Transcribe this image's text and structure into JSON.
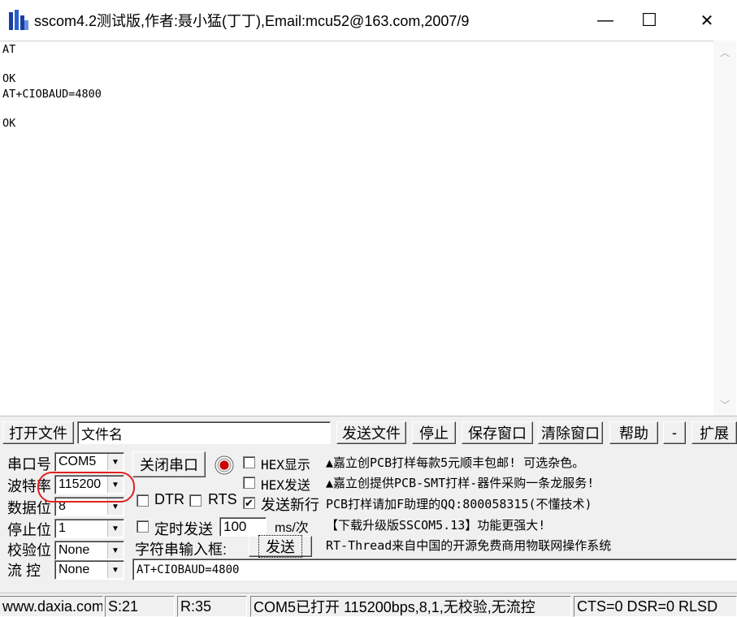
{
  "window": {
    "title": "sscom4.2测试版,作者:聂小猛(丁丁),Email:mcu52@163.com,2007/9",
    "minimize": "—",
    "maximize": "☐",
    "close": "✕"
  },
  "receive": {
    "text": "AT\n\nOK\nAT+CIOBAUD=4800\n\nOK"
  },
  "toolbar": {
    "open_file": "打开文件",
    "filename": "文件名",
    "send_file": "发送文件",
    "stop": "停止",
    "save_window": "保存窗口",
    "clear_window": "清除窗口",
    "help": "帮助",
    "collapse": "-",
    "expand": "扩展"
  },
  "settings": {
    "port_label": "串口号",
    "port_value": "COM5",
    "baud_label": "波特率",
    "baud_value": "115200",
    "databits_label": "数据位",
    "databits_value": "8",
    "stopbits_label": "停止位",
    "stopbits_value": "1",
    "parity_label": "校验位",
    "parity_value": "None",
    "flow_label": "流 控",
    "flow_value": "None"
  },
  "controls": {
    "close_port": "关闭串口",
    "hex_display": "HEX显示",
    "hex_send": "HEX发送",
    "dtr": "DTR",
    "rts": "RTS",
    "send_newline": "发送新行",
    "timed_send": "定时发送",
    "interval_value": "100",
    "interval_unit": "ms/次",
    "input_label": "字符串输入框:",
    "send": "发送",
    "input_value": "AT+CIOBAUD=4800"
  },
  "checkbox_states": {
    "hex_display": false,
    "hex_send": false,
    "dtr": false,
    "rts": false,
    "send_newline": true,
    "timed_send": false
  },
  "info": {
    "line1": "▲嘉立创PCB打样每款5元顺丰包邮! 可选杂色。",
    "line2": "▲嘉立创提供PCB-SMT打样-器件采购一条龙服务!",
    "line3": "PCB打样请加F助理的QQ:800058315(不懂技术)",
    "line4": "【下载升级版SSCOM5.13】功能更强大!",
    "line5": "RT-Thread来自中国的开源免费商用物联网操作系统"
  },
  "status": {
    "website": "www.daxia.com",
    "sent": "S:21",
    "received": "R:35",
    "port_status": "COM5已打开  115200bps,8,1,无校验,无流控",
    "signals": "CTS=0 DSR=0 RLSD"
  },
  "colors": {
    "annotation_circle": "#e02020",
    "record_light": "#cc0000"
  }
}
